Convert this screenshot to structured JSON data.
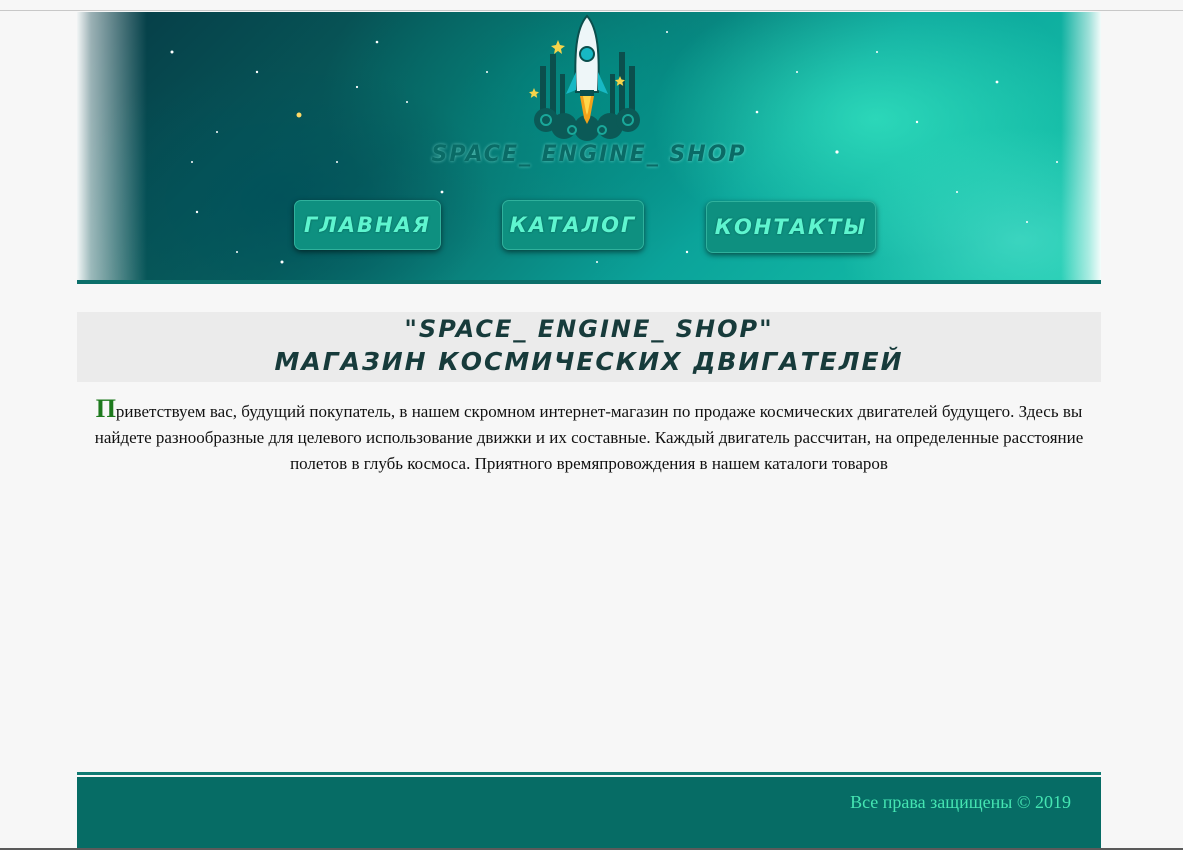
{
  "header": {
    "logo_text": "SPACE_ ENGINE_ SHOP",
    "nav": [
      {
        "label": "ГЛАВНАЯ"
      },
      {
        "label": "КАТАЛОГ"
      },
      {
        "label": "КОНТАКТЫ"
      }
    ]
  },
  "main": {
    "title_line1": "\"SPACE_ ENGINE_ SHOP\"",
    "title_line2": "МАГАЗИН КОСМИЧЕСКИХ ДВИГАТЕЛЕЙ",
    "intro_first_letter": "П",
    "intro_text": "риветствуем вас, будущий покупатель, в нашем скромном интернет-магазин по продаже космических двигателей будущего. Здесь вы найдете разнообразные для целевого использование движки и их составные. Каждый двигатель рассчитан, на определенные расстояние полетов в глубь космоса. Приятного времяпровождения в нашем каталоги товаров"
  },
  "footer": {
    "copyright": "Все права защищены © 2019"
  },
  "colors": {
    "accent": "#066c65",
    "nav_text": "#5ef5cf",
    "footer_text": "#45e5b2",
    "drop_letter": "#1e7a1e"
  },
  "icons": {
    "logo": "rocket-icon"
  }
}
